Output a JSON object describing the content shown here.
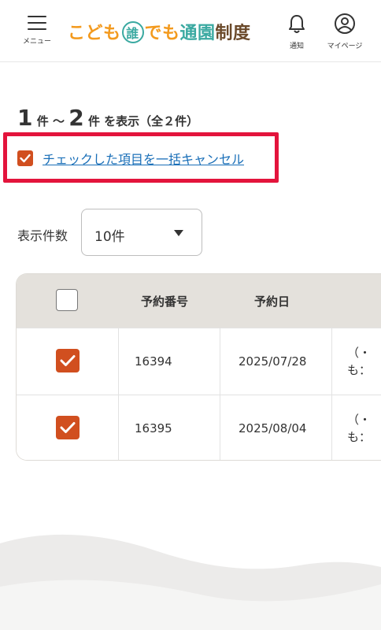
{
  "header": {
    "menu_label": "メニュー",
    "logo_part1": "こども",
    "logo_circle": "誰",
    "logo_part2": "でも",
    "logo_part3": "通園",
    "logo_part4": "制度",
    "notice_label": "通知",
    "mypage_label": "マイページ"
  },
  "summary": {
    "from": "1",
    "from_suffix": "件",
    "tilde": "～",
    "to": "2",
    "to_suffix": "件 を表示（全２件）"
  },
  "bulk_cancel": {
    "checked": true,
    "label": "チェックした項目を一括キャンセル"
  },
  "page_size": {
    "label": "表示件数",
    "value": "10件"
  },
  "table": {
    "columns": [
      "",
      "予約番号",
      "予約日"
    ],
    "rows": [
      {
        "checked": true,
        "number": "16394",
        "date": "2025/07/28",
        "trunc1": "（・",
        "trunc2": "も："
      },
      {
        "checked": true,
        "number": "16395",
        "date": "2025/08/04",
        "trunc1": "（・",
        "trunc2": "も："
      }
    ]
  },
  "colors": {
    "accent": "#d14f1f",
    "highlight_border": "#e3143c",
    "link": "#1a6fb8",
    "header_row": "#e4e1dc"
  }
}
